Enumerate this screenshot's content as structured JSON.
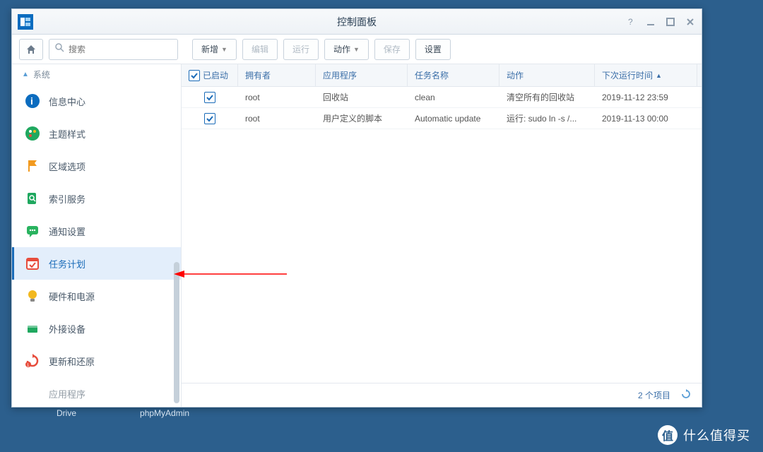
{
  "window": {
    "title": "控制面板"
  },
  "search": {
    "placeholder": "搜索"
  },
  "toolbar": {
    "new": "新增",
    "edit": "编辑",
    "run": "运行",
    "action": "动作",
    "save": "保存",
    "settings": "设置"
  },
  "sidebar": {
    "group": "系统",
    "items": [
      {
        "label": "信息中心",
        "icon": "info",
        "color": "#0b6cbf"
      },
      {
        "label": "主题样式",
        "icon": "palette",
        "color": "#1fa85f"
      },
      {
        "label": "区域选项",
        "icon": "flag",
        "color": "#f29a1f"
      },
      {
        "label": "索引服务",
        "icon": "search-doc",
        "color": "#1fa85f"
      },
      {
        "label": "通知设置",
        "icon": "chat",
        "color": "#29b35f"
      },
      {
        "label": "任务计划",
        "icon": "calendar",
        "color": "#e74c3c",
        "active": true
      },
      {
        "label": "硬件和电源",
        "icon": "bulb",
        "color": "#f2b81f"
      },
      {
        "label": "外接设备",
        "icon": "drive",
        "color": "#1fa85f"
      },
      {
        "label": "更新和还原",
        "icon": "update",
        "color": "#e74c3c"
      },
      {
        "label": "应用程序",
        "icon": "",
        "color": "#888",
        "truncated": true
      }
    ]
  },
  "grid": {
    "headers": {
      "enabled": "已启动",
      "owner": "拥有者",
      "app": "应用程序",
      "task": "任务名称",
      "action": "动作",
      "next": "下次运行时间"
    },
    "rows": [
      {
        "enabled": true,
        "owner": "root",
        "app": "回收站",
        "task": "clean",
        "action": "清空所有的回收站",
        "next": "2019-11-12 23:59"
      },
      {
        "enabled": true,
        "owner": "root",
        "app": "用户定义的脚本",
        "task": "Automatic update",
        "action": "运行: sudo ln -s /...",
        "next": "2019-11-13 00:00"
      }
    ]
  },
  "status": {
    "count": "2 个项目"
  },
  "desktop": {
    "drive": "Drive",
    "pma": "phpMyAdmin"
  },
  "watermark": {
    "badge": "值",
    "text": "什么值得买"
  }
}
